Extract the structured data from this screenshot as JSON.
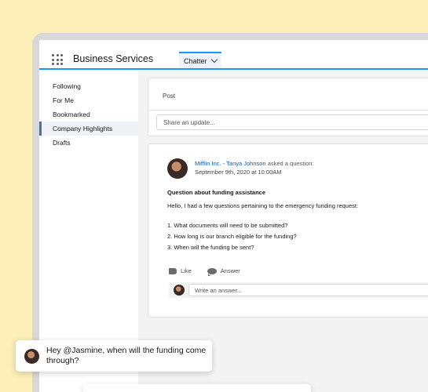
{
  "header": {
    "app_name": "Business Services",
    "active_tab": "Chatter"
  },
  "sidebar": {
    "items": [
      {
        "label": "Following"
      },
      {
        "label": "For Me"
      },
      {
        "label": "Bookmarked"
      },
      {
        "label": "Company Highlights"
      },
      {
        "label": "Drafts"
      }
    ],
    "active_index": 3
  },
  "composer": {
    "tab_label": "Post",
    "placeholder": "Share an update..."
  },
  "feed_item": {
    "author_link": "Mifflin Inc. - Tanya Johnson",
    "action_text": "asked a question:",
    "date": "September 9th, 2020 at 10:00AM",
    "question_title": "Question about funding assistance",
    "intro": "Hello, I had a few questions pertaining to the emergency funding request:",
    "questions": [
      "1. What documents will need to be submitted?",
      "2. How long is our branch eligible for the funding?",
      "3. When will the funding be sent?"
    ],
    "like_label": "Like",
    "answer_label": "Answer",
    "answer_placeholder": "Write an answer..."
  },
  "toast": {
    "message": "Hey @Jasmine, when will the funding come through?"
  },
  "colors": {
    "background": "#fbeeb7",
    "accent": "#1b96ff",
    "link": "#0b5cab"
  }
}
